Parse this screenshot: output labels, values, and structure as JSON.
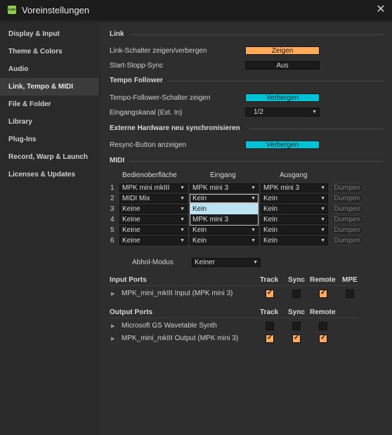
{
  "window": {
    "title": "Voreinstellungen",
    "app_icon_text": "Live",
    "close_glyph": "✕"
  },
  "sidebar": {
    "items": [
      {
        "label": "Display & Input"
      },
      {
        "label": "Theme & Colors"
      },
      {
        "label": "Audio"
      },
      {
        "label": "Link, Tempo & MIDI",
        "selected": true
      },
      {
        "label": "File & Folder"
      },
      {
        "label": "Library"
      },
      {
        "label": "Plug-Ins"
      },
      {
        "label": "Record, Warp & Launch"
      },
      {
        "label": "Licenses & Updates"
      }
    ]
  },
  "link": {
    "heading": "Link",
    "toggle_label": "Link-Schalter zeigen/verbergen",
    "toggle_value": "Zeigen",
    "sync_label": "Start-Stopp-Sync",
    "sync_value": "Aus"
  },
  "tempo": {
    "heading": "Tempo Follower",
    "toggle_label": "Tempo-Follower-Schalter zeigen",
    "toggle_value": "Verbergen",
    "channel_label": "Eingangskanal (Ext. In)",
    "channel_value": "1/2"
  },
  "resync": {
    "heading": "Externe Hardware neu synchronisieren",
    "button_label": "Resync-Button anzeigen",
    "button_value": "Verbergen"
  },
  "midi": {
    "heading": "MIDI",
    "col_surface": "Bedienoberfläche",
    "col_input": "Eingang",
    "col_output": "Ausgang",
    "dump_label": "Dumpen",
    "rows": [
      {
        "num": "1",
        "surface": "MPK mini mkIII",
        "input": "MPK mini 3",
        "output": "MPK mini 3"
      },
      {
        "num": "2",
        "surface": "MIDI Mix",
        "input": "Kein",
        "output": "Kein"
      },
      {
        "num": "3",
        "surface": "Keine",
        "input": "Kein",
        "output": "Kein"
      },
      {
        "num": "4",
        "surface": "Keine",
        "input": "Kein",
        "output": "Kein"
      },
      {
        "num": "5",
        "surface": "Keine",
        "input": "Kein",
        "output": "Kein"
      },
      {
        "num": "6",
        "surface": "Keine",
        "input": "Kein",
        "output": "Kein"
      }
    ],
    "open_menu": {
      "items": [
        "Kein",
        "MPK mini 3"
      ],
      "highlighted": "Kein"
    },
    "takeover_label": "Abhol-Modus",
    "takeover_value": "Keiner"
  },
  "input_ports": {
    "heading": "Input Ports",
    "col_track": "Track",
    "col_sync": "Sync",
    "col_remote": "Remote",
    "col_mpe": "MPE",
    "ports": [
      {
        "name": "MPK_mini_mkIII Input (MPK mini 3)",
        "track": true,
        "sync": false,
        "remote": true,
        "mpe": false
      }
    ]
  },
  "output_ports": {
    "heading": "Output Ports",
    "col_track": "Track",
    "col_sync": "Sync",
    "col_remote": "Remote",
    "ports": [
      {
        "name": "Microsoft GS Wavetable Synth",
        "track": false,
        "sync": false,
        "remote": false
      },
      {
        "name": "MPK_mini_mkIII Output (MPK mini 3)",
        "track": true,
        "sync": true,
        "remote": true
      }
    ]
  },
  "colors": {
    "accent_orange": "#ffa959",
    "accent_cyan": "#00c2d4",
    "menu_highlight": "#bce3f2"
  },
  "icons": {
    "expand": "triangle-right-icon",
    "dropdown": "chevron-down-icon",
    "close": "close-icon"
  }
}
